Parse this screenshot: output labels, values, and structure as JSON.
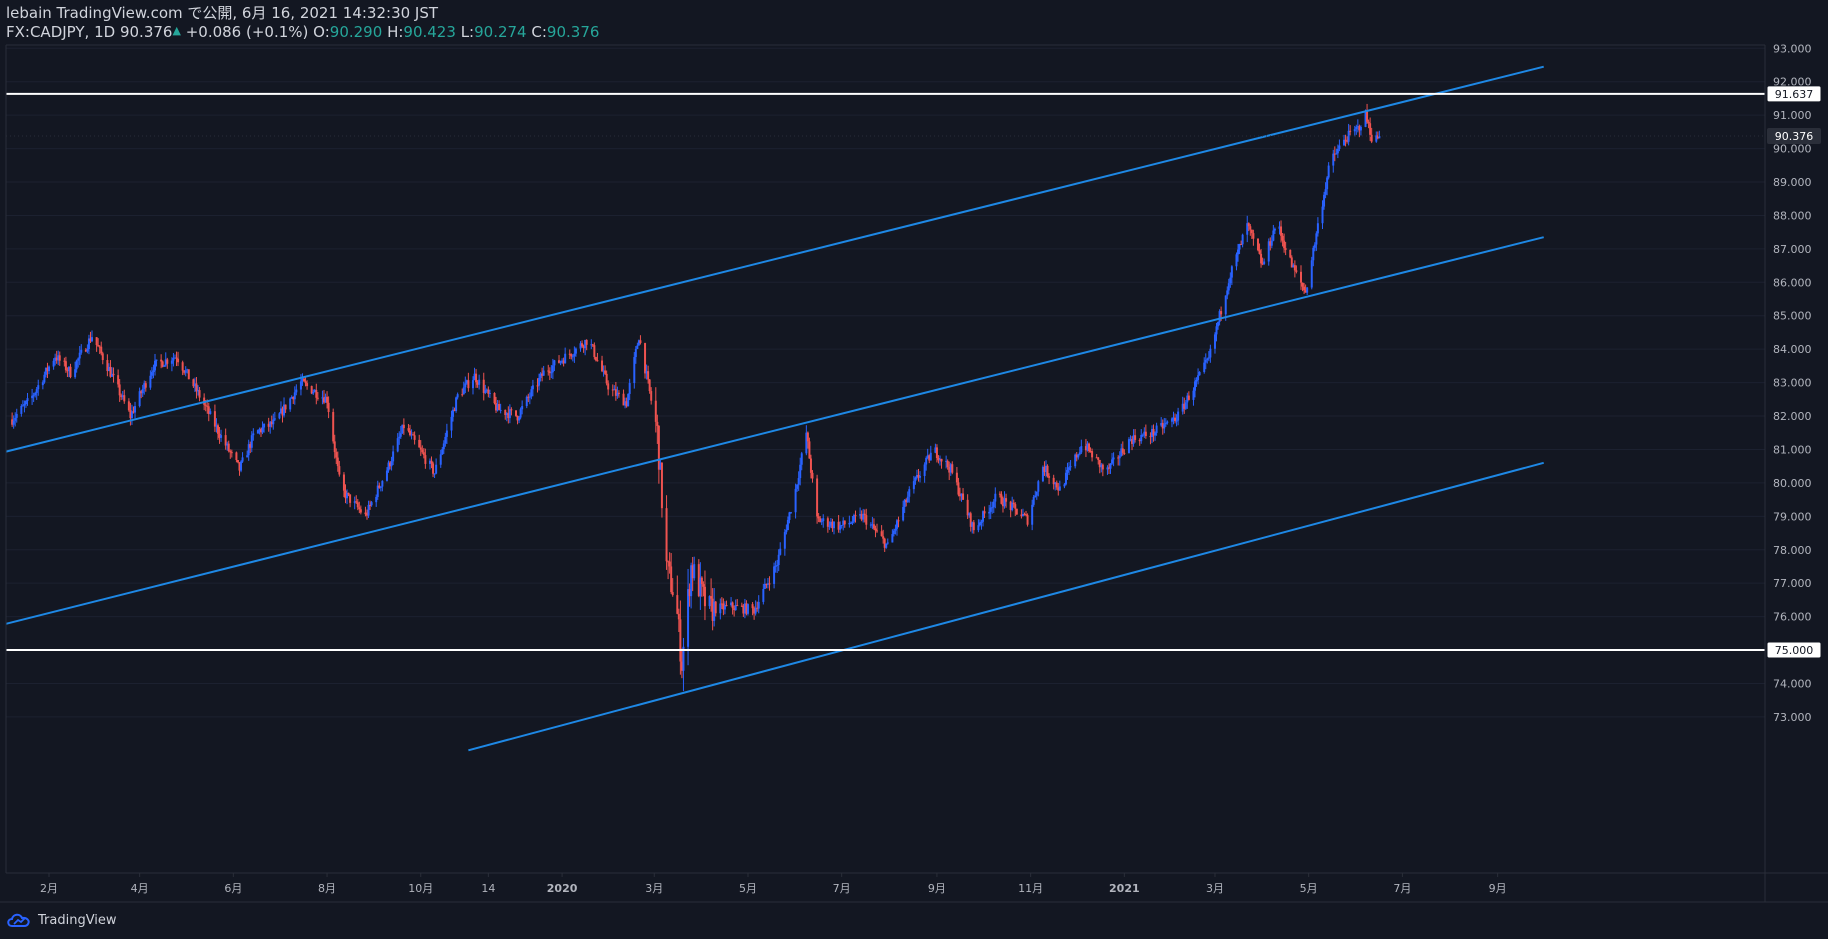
{
  "header": {
    "publisher_line": "lebain TradingView.com で公開, 6月 16, 2021 14:32:30 JST",
    "symbol": "FX:CADJPY, 1D",
    "last": "90.376",
    "change": "+0.086 (+0.1%)",
    "o_label": "O:",
    "o_value": "90.290",
    "h_label": "H:",
    "h_value": "90.423",
    "l_label": "L:",
    "l_value": "90.274",
    "c_label": "C:",
    "c_value": "90.376"
  },
  "footer": {
    "brand": "TradingView",
    "logo_icon": "tradingview-cloud-icon"
  },
  "colors": {
    "background": "#131722",
    "up": "#2962ff",
    "down": "#ef5350",
    "channel": "#1e88e5",
    "level_line": "#ffffff",
    "axis_text": "#b2b5be",
    "green": "#26a69a"
  },
  "chart_data": {
    "type": "candlestick",
    "symbol": "FX:CADJPY",
    "timeframe": "1D",
    "date_range": [
      "2019-01",
      "2021-09"
    ],
    "ylim": [
      72.0,
      93.3
    ],
    "y_ticks": [
      "93.000",
      "92.000",
      "91.000",
      "90.000",
      "89.000",
      "88.000",
      "87.000",
      "86.000",
      "85.000",
      "84.000",
      "83.000",
      "82.000",
      "81.000",
      "80.000",
      "79.000",
      "78.000",
      "77.000",
      "76.000",
      "75.000",
      "74.000",
      "73.000"
    ],
    "x_ticks": [
      {
        "label": "2月",
        "date": "2019-02-01"
      },
      {
        "label": "4月",
        "date": "2019-04-01"
      },
      {
        "label": "6月",
        "date": "2019-06-01"
      },
      {
        "label": "8月",
        "date": "2019-08-01"
      },
      {
        "label": "10月",
        "date": "2019-10-01"
      },
      {
        "label": "14",
        "date": "2019-11-14"
      },
      {
        "label": "2020",
        "date": "2020-01-01"
      },
      {
        "label": "3月",
        "date": "2020-03-01"
      },
      {
        "label": "5月",
        "date": "2020-05-01"
      },
      {
        "label": "7月",
        "date": "2020-07-01"
      },
      {
        "label": "9月",
        "date": "2020-09-01"
      },
      {
        "label": "11月",
        "date": "2020-11-01"
      },
      {
        "label": "2021",
        "date": "2021-01-01"
      },
      {
        "label": "3月",
        "date": "2021-03-01"
      },
      {
        "label": "5月",
        "date": "2021-05-01"
      },
      {
        "label": "7月",
        "date": "2021-07-01"
      },
      {
        "label": "9月",
        "date": "2021-09-01"
      }
    ],
    "price_path": [
      {
        "date": "2019-01-08",
        "price": 81.9
      },
      {
        "date": "2019-01-20",
        "price": 82.5
      },
      {
        "date": "2019-02-05",
        "price": 83.8
      },
      {
        "date": "2019-02-15",
        "price": 83.3
      },
      {
        "date": "2019-03-01",
        "price": 84.4
      },
      {
        "date": "2019-03-12",
        "price": 83.4
      },
      {
        "date": "2019-03-26",
        "price": 82.0
      },
      {
        "date": "2019-04-10",
        "price": 83.5
      },
      {
        "date": "2019-04-25",
        "price": 83.8
      },
      {
        "date": "2019-05-10",
        "price": 82.6
      },
      {
        "date": "2019-05-25",
        "price": 81.3
      },
      {
        "date": "2019-06-05",
        "price": 80.4
      },
      {
        "date": "2019-06-15",
        "price": 81.5
      },
      {
        "date": "2019-06-28",
        "price": 81.8
      },
      {
        "date": "2019-07-15",
        "price": 83.0
      },
      {
        "date": "2019-08-01",
        "price": 82.5
      },
      {
        "date": "2019-08-10",
        "price": 79.8
      },
      {
        "date": "2019-08-26",
        "price": 79.0
      },
      {
        "date": "2019-09-10",
        "price": 80.5
      },
      {
        "date": "2019-09-20",
        "price": 81.7
      },
      {
        "date": "2019-10-10",
        "price": 80.3
      },
      {
        "date": "2019-10-25",
        "price": 82.6
      },
      {
        "date": "2019-11-05",
        "price": 83.2
      },
      {
        "date": "2019-11-20",
        "price": 82.2
      },
      {
        "date": "2019-12-03",
        "price": 82.0
      },
      {
        "date": "2019-12-20",
        "price": 83.3
      },
      {
        "date": "2020-01-10",
        "price": 84.0
      },
      {
        "date": "2020-01-18",
        "price": 84.3
      },
      {
        "date": "2020-02-01",
        "price": 82.8
      },
      {
        "date": "2020-02-12",
        "price": 82.4
      },
      {
        "date": "2020-02-20",
        "price": 84.4
      },
      {
        "date": "2020-03-03",
        "price": 81.5
      },
      {
        "date": "2020-03-09",
        "price": 77.5
      },
      {
        "date": "2020-03-15",
        "price": 76.5
      },
      {
        "date": "2020-03-19",
        "price": 74.6
      },
      {
        "date": "2020-03-25",
        "price": 77.5
      },
      {
        "date": "2020-04-05",
        "price": 76.2
      },
      {
        "date": "2020-04-20",
        "price": 76.3
      },
      {
        "date": "2020-05-05",
        "price": 76.2
      },
      {
        "date": "2020-05-20",
        "price": 77.6
      },
      {
        "date": "2020-06-01",
        "price": 79.8
      },
      {
        "date": "2020-06-08",
        "price": 81.5
      },
      {
        "date": "2020-06-15",
        "price": 78.9
      },
      {
        "date": "2020-06-30",
        "price": 78.7
      },
      {
        "date": "2020-07-15",
        "price": 79.0
      },
      {
        "date": "2020-07-31",
        "price": 78.1
      },
      {
        "date": "2020-08-15",
        "price": 79.8
      },
      {
        "date": "2020-08-30",
        "price": 81.0
      },
      {
        "date": "2020-09-10",
        "price": 80.4
      },
      {
        "date": "2020-09-25",
        "price": 78.6
      },
      {
        "date": "2020-10-10",
        "price": 79.6
      },
      {
        "date": "2020-10-30",
        "price": 78.9
      },
      {
        "date": "2020-11-09",
        "price": 80.5
      },
      {
        "date": "2020-11-20",
        "price": 79.8
      },
      {
        "date": "2020-12-05",
        "price": 81.2
      },
      {
        "date": "2020-12-20",
        "price": 80.3
      },
      {
        "date": "2021-01-05",
        "price": 81.3
      },
      {
        "date": "2021-01-20",
        "price": 81.5
      },
      {
        "date": "2021-02-05",
        "price": 82.0
      },
      {
        "date": "2021-02-25",
        "price": 83.7
      },
      {
        "date": "2021-03-10",
        "price": 86.1
      },
      {
        "date": "2021-03-22",
        "price": 87.7
      },
      {
        "date": "2021-04-01",
        "price": 86.5
      },
      {
        "date": "2021-04-10",
        "price": 87.8
      },
      {
        "date": "2021-04-20",
        "price": 86.5
      },
      {
        "date": "2021-04-29",
        "price": 85.7
      },
      {
        "date": "2021-05-07",
        "price": 87.7
      },
      {
        "date": "2021-05-15",
        "price": 89.6
      },
      {
        "date": "2021-05-25",
        "price": 90.3
      },
      {
        "date": "2021-06-02",
        "price": 90.6
      },
      {
        "date": "2021-06-07",
        "price": 91.0
      },
      {
        "date": "2021-06-12",
        "price": 90.2
      },
      {
        "date": "2021-06-16",
        "price": 90.376
      }
    ],
    "channel_lines": [
      {
        "name": "upper",
        "p1": {
          "date": "2019-01-01",
          "price": 80.9
        },
        "p2": {
          "date": "2021-10-01",
          "price": 92.45
        }
      },
      {
        "name": "middle",
        "p1": {
          "date": "2019-01-01",
          "price": 75.75
        },
        "p2": {
          "date": "2021-10-01",
          "price": 87.35
        }
      },
      {
        "name": "lower",
        "p1": {
          "date": "2019-11-01",
          "price": 72.0
        },
        "p2": {
          "date": "2021-10-01",
          "price": 80.6
        }
      }
    ],
    "horizontal_levels": [
      {
        "price": 91.637,
        "label": "91.637"
      },
      {
        "price": 75.0,
        "label": "75.000"
      }
    ],
    "last_price": {
      "price": 90.376,
      "label": "90.376"
    }
  }
}
